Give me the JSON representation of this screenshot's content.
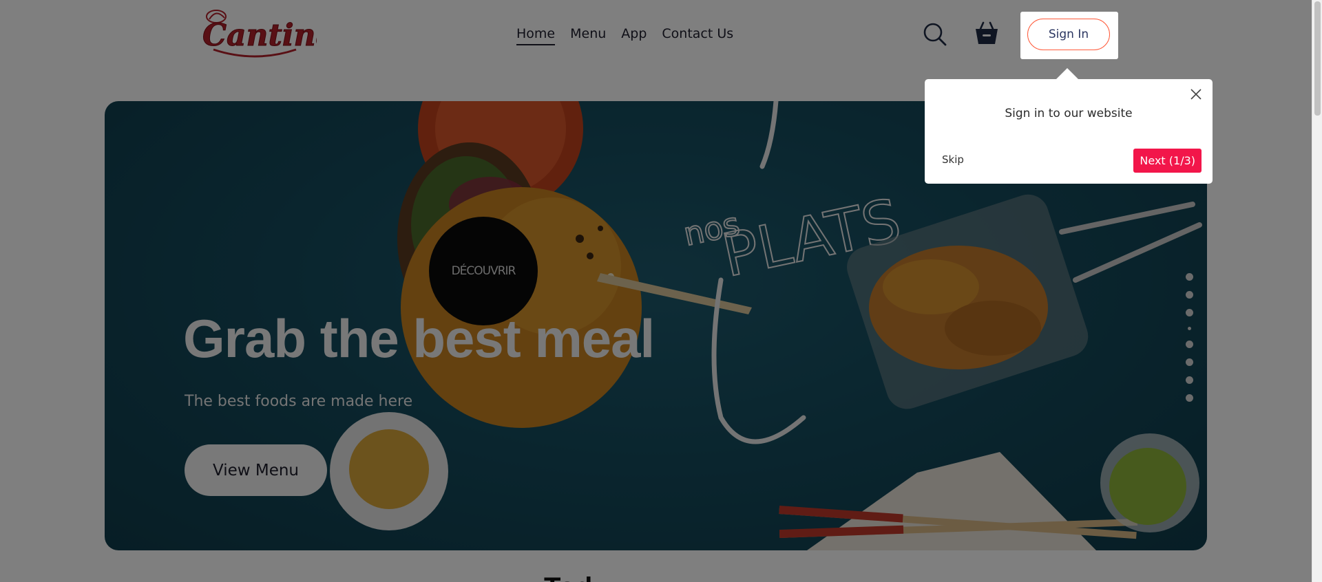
{
  "header": {
    "logo_text": "Cantina's",
    "nav": [
      {
        "label": "Home",
        "active": true
      },
      {
        "label": "Menu",
        "active": false
      },
      {
        "label": "App",
        "active": false
      },
      {
        "label": "Contact Us",
        "active": false
      }
    ],
    "search_icon": "search-icon",
    "cart_icon": "basket-icon",
    "sign_in_label": "Sign In"
  },
  "hero": {
    "title": "Grab the best meal",
    "subtitle": "The best foods are made here",
    "cta_label": "View Menu",
    "decouvrir_label": "DÉCOUVRIR",
    "script_text": "nos PLATS",
    "slide_count": 8,
    "active_slide": 4
  },
  "below": {
    "heading_partial": "Tod"
  },
  "tour": {
    "title": "Sign in to our website",
    "skip_label": "Skip",
    "next_label": "Next (1/3)"
  },
  "colors": {
    "accent": "#f2164a",
    "signin_border": "#ff5a3a",
    "hero_bg": "#144a5c",
    "logo_red": "#b3212b"
  }
}
